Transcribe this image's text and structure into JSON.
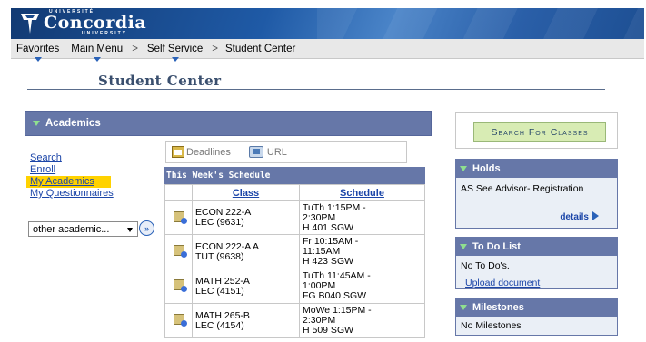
{
  "banner": {
    "superscript": "UNIVERSITÉ",
    "name": "Concordia",
    "subscript": "UNIVERSITY"
  },
  "nav": {
    "favorites": "Favorites",
    "main_menu": "Main Menu",
    "crumb_sep": ">",
    "self_service": "Self Service",
    "student_center": "Student Center"
  },
  "page": {
    "title": "Student Center"
  },
  "academics": {
    "header": "Academics",
    "links": [
      "Search",
      "Enroll",
      "My Academics",
      "My Questionnaires"
    ],
    "other_select": "other academic...",
    "go_label": "»"
  },
  "deadlines": {
    "deadlines_label": "Deadlines",
    "url_label": "URL"
  },
  "schedule": {
    "header": "This Week's Schedule",
    "columns": [
      "Class",
      "Schedule"
    ],
    "rows": [
      {
        "class_line1": "ECON 222-A",
        "class_line2": "LEC (9631)",
        "sched_line1": "TuTh 1:15PM -",
        "sched_line2": "2:30PM",
        "sched_line3": "H 401 SGW"
      },
      {
        "class_line1": "ECON 222-A A",
        "class_line2": "TUT (9638)",
        "sched_line1": "Fr 10:15AM -",
        "sched_line2": "11:15AM",
        "sched_line3": "H 423 SGW"
      },
      {
        "class_line1": "MATH 252-A",
        "class_line2": "LEC (4151)",
        "sched_line1": "TuTh 11:45AM -",
        "sched_line2": "1:00PM",
        "sched_line3": "FG B040 SGW"
      },
      {
        "class_line1": "MATH 265-B",
        "class_line2": "LEC (4154)",
        "sched_line1": "MoWe 1:15PM -",
        "sched_line2": "2:30PM",
        "sched_line3": "H 509 SGW"
      }
    ]
  },
  "right": {
    "search_button": "Search For Classes",
    "holds": {
      "header": "Holds",
      "text": "AS See Advisor- Registration",
      "details": "details"
    },
    "todo": {
      "header": "To Do List",
      "text": "No To Do's.",
      "upload": "Upload document"
    },
    "milestones": {
      "header": "Milestones",
      "text": "No Milestones"
    }
  },
  "colors": {
    "header_blue": "#6677a8",
    "banner_blue": "#1a4a8c",
    "highlight": "#ffd200",
    "link": "#1b45a8",
    "search_green": "#d8ecb4"
  }
}
